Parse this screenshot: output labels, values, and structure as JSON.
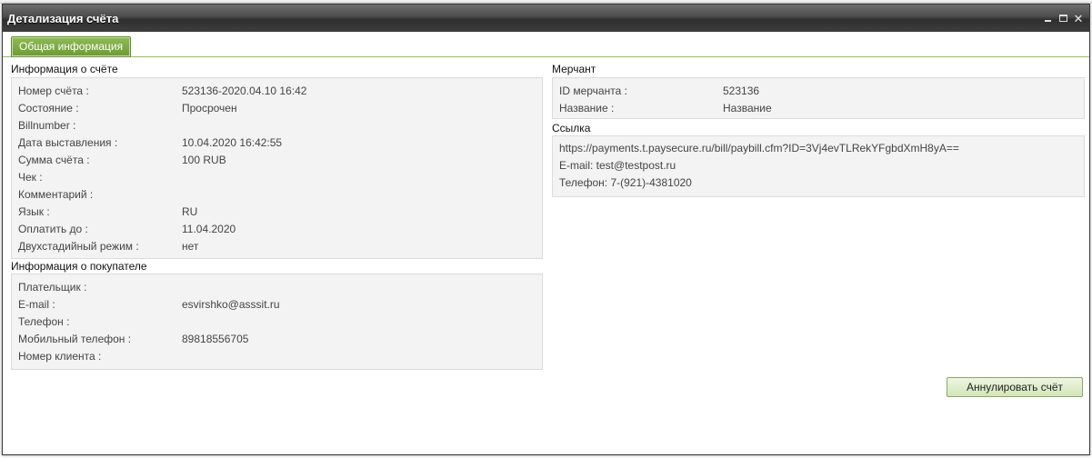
{
  "window": {
    "title": "Детализация счёта"
  },
  "tabs": [
    {
      "label": "Общая информация",
      "active": true
    }
  ],
  "bill_info": {
    "title": "Информация о счёте",
    "rows": [
      {
        "label": "Номер счёта :",
        "value": "523136-2020.04.10 16:42"
      },
      {
        "label": "Состояние :",
        "value": "Просрочен"
      },
      {
        "label": "Billnumber :",
        "value": ""
      },
      {
        "label": "Дата выставления :",
        "value": "10.04.2020 16:42:55"
      },
      {
        "label": "Сумма счёта :",
        "value": "100 RUB"
      },
      {
        "label": "Чек :",
        "value": ""
      },
      {
        "label": "Комментарий :",
        "value": ""
      },
      {
        "label": "Язык :",
        "value": "RU"
      },
      {
        "label": "Оплатить до :",
        "value": "11.04.2020"
      },
      {
        "label": "Двухстадийный режим :",
        "value": "нет"
      }
    ]
  },
  "buyer_info": {
    "title": "Информация о покупателе",
    "rows": [
      {
        "label": "Плательщик :",
        "value": ""
      },
      {
        "label": "E-mail :",
        "value": "esvirshko@asssit.ru"
      },
      {
        "label": "Телефон :",
        "value": ""
      },
      {
        "label": "Мобильный телефон :",
        "value": "89818556705"
      },
      {
        "label": "Номер клиента :",
        "value": ""
      }
    ]
  },
  "merchant": {
    "title": "Мерчант",
    "rows": [
      {
        "label": "ID мерчанта :",
        "value": "523136"
      },
      {
        "label": "Название :",
        "value": "Название"
      }
    ]
  },
  "link": {
    "title": "Ссылка",
    "url": "https://payments.t.paysecure.ru/bill/paybill.cfm?ID=3Vj4evTLRekYFgbdXmH8yA==",
    "email_line": "E-mail:  test@testpost.ru",
    "phone_line": "Телефон: 7-(921)-4381020"
  },
  "actions": {
    "cancel_label": "Аннулировать счёт"
  },
  "colors": {
    "tab_green": "#7aa840",
    "titlebar_dark": "#3d3d3d",
    "button_green": "#d3e6b8"
  }
}
